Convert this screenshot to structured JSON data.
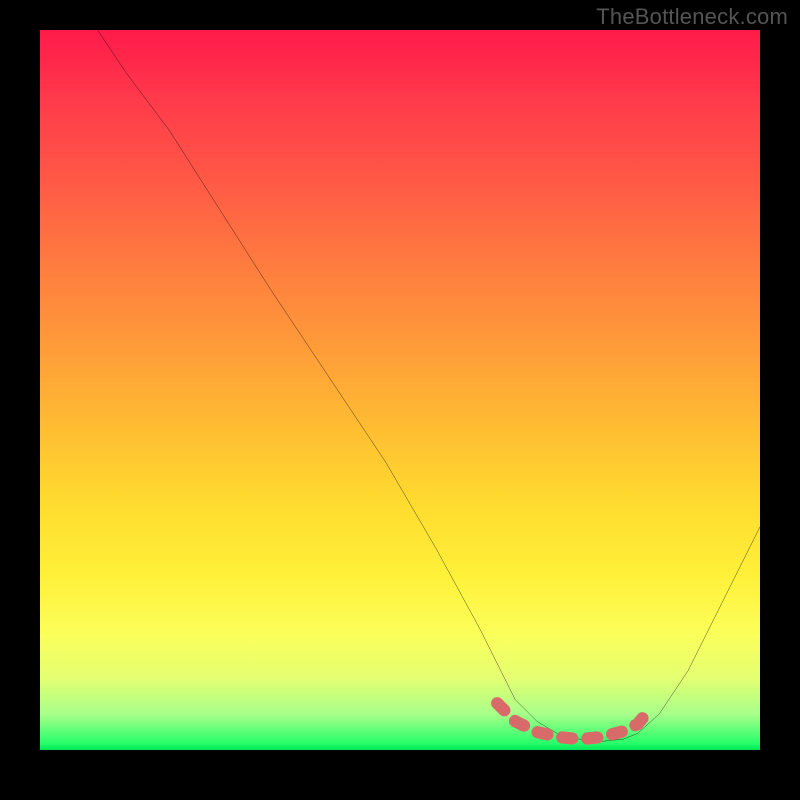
{
  "watermark": "TheBottleneck.com",
  "chart_data": {
    "type": "line",
    "title": "",
    "xlabel": "",
    "ylabel": "",
    "xlim": [
      0,
      100
    ],
    "ylim": [
      0,
      100
    ],
    "grid": false,
    "series": [
      {
        "name": "main-curve",
        "color": "#000000",
        "x": [
          8,
          12,
          18,
          25,
          32,
          40,
          48,
          55,
          61,
          64,
          66,
          69,
          72,
          75,
          78,
          81,
          83,
          86,
          90,
          94,
          98,
          100
        ],
        "y": [
          100,
          94,
          86,
          75,
          64,
          52,
          40,
          28,
          17,
          11,
          7,
          4,
          2.2,
          1.5,
          1.2,
          1.5,
          2.3,
          5,
          11,
          19,
          27,
          31
        ]
      },
      {
        "name": "bottom-overlay",
        "color": "#d96a6a",
        "x": [
          63.5,
          66,
          69,
          72,
          75,
          78,
          81,
          83,
          85
        ],
        "y": [
          6.5,
          4,
          2.5,
          1.8,
          1.5,
          1.8,
          2.6,
          3.6,
          6
        ]
      }
    ],
    "background": {
      "type": "vertical-gradient",
      "stops": [
        {
          "pos": 0,
          "color": "#ff1a4a"
        },
        {
          "pos": 0.33,
          "color": "#ff7d3f"
        },
        {
          "pos": 0.66,
          "color": "#ffdc2f"
        },
        {
          "pos": 0.9,
          "color": "#e4ff72"
        },
        {
          "pos": 1.0,
          "color": "#00e858"
        }
      ]
    }
  }
}
